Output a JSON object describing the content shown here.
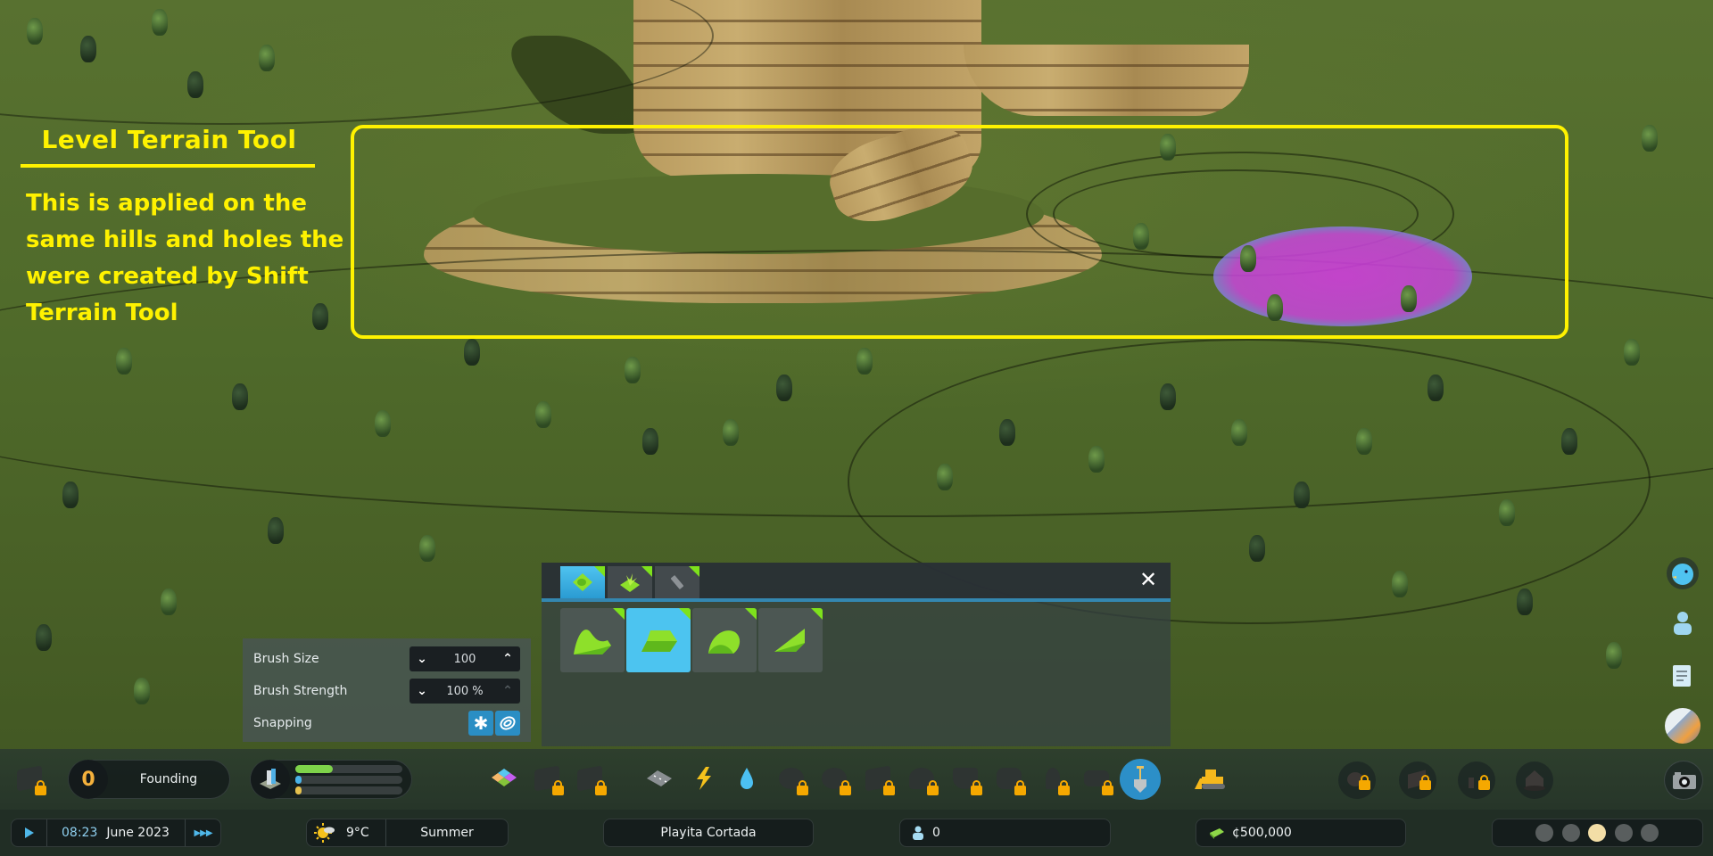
{
  "annotation": {
    "title": "Level Terrain Tool",
    "body": "This is applied on the same hills and holes the were created by Shift Terrain Tool",
    "color": "#fff200"
  },
  "terrain_panel": {
    "tabs": [
      {
        "icon": "terrain-tab-icon",
        "active": true
      },
      {
        "icon": "vegetation-tab-icon",
        "active": false
      },
      {
        "icon": "surface-tab-icon",
        "active": false
      }
    ],
    "tools": [
      {
        "icon": "shift-terrain-icon",
        "active": false
      },
      {
        "icon": "level-terrain-icon",
        "active": true
      },
      {
        "icon": "soften-terrain-icon",
        "active": false
      },
      {
        "icon": "slope-terrain-icon",
        "active": false
      }
    ],
    "close_icon": "close-icon",
    "accent": "#4cc4f0",
    "badge_color": "#7ee21c"
  },
  "brush_settings": {
    "size_label": "Brush Size",
    "size_value": "100",
    "strength_label": "Brush Strength",
    "strength_value": "100 %",
    "snapping_label": "Snapping"
  },
  "toolbar": {
    "milestone_value": "0",
    "milestone_label": "Founding",
    "progress": {
      "green": 0.35,
      "blue": 0.03,
      "yellow": 0.03
    },
    "tools": [
      "zoning-icon",
      "area-icon",
      "landscaping-icon",
      "roads-icon",
      "electricity-icon",
      "water-icon",
      "health-icon",
      "garbage-icon",
      "education-icon",
      "fire-icon",
      "police-icon",
      "transport-icon",
      "parks-icon",
      "communications-icon",
      "terraform-shovel-icon",
      "bulldozer-icon"
    ],
    "right_tools": [
      "progression-icon",
      "economy-icon",
      "statistics-icon",
      "residential-icon",
      "photo-mode-icon"
    ]
  },
  "statusbar": {
    "time": "08:23",
    "date": "June 2023",
    "temperature": "9°C",
    "season": "Summer",
    "city_name": "Playita Cortada",
    "population": "0",
    "money": "¢500,000",
    "happiness_level": 3
  },
  "sidebar": [
    "chirper-icon",
    "citizens-icon",
    "journal-icon",
    "info-views-icon"
  ]
}
